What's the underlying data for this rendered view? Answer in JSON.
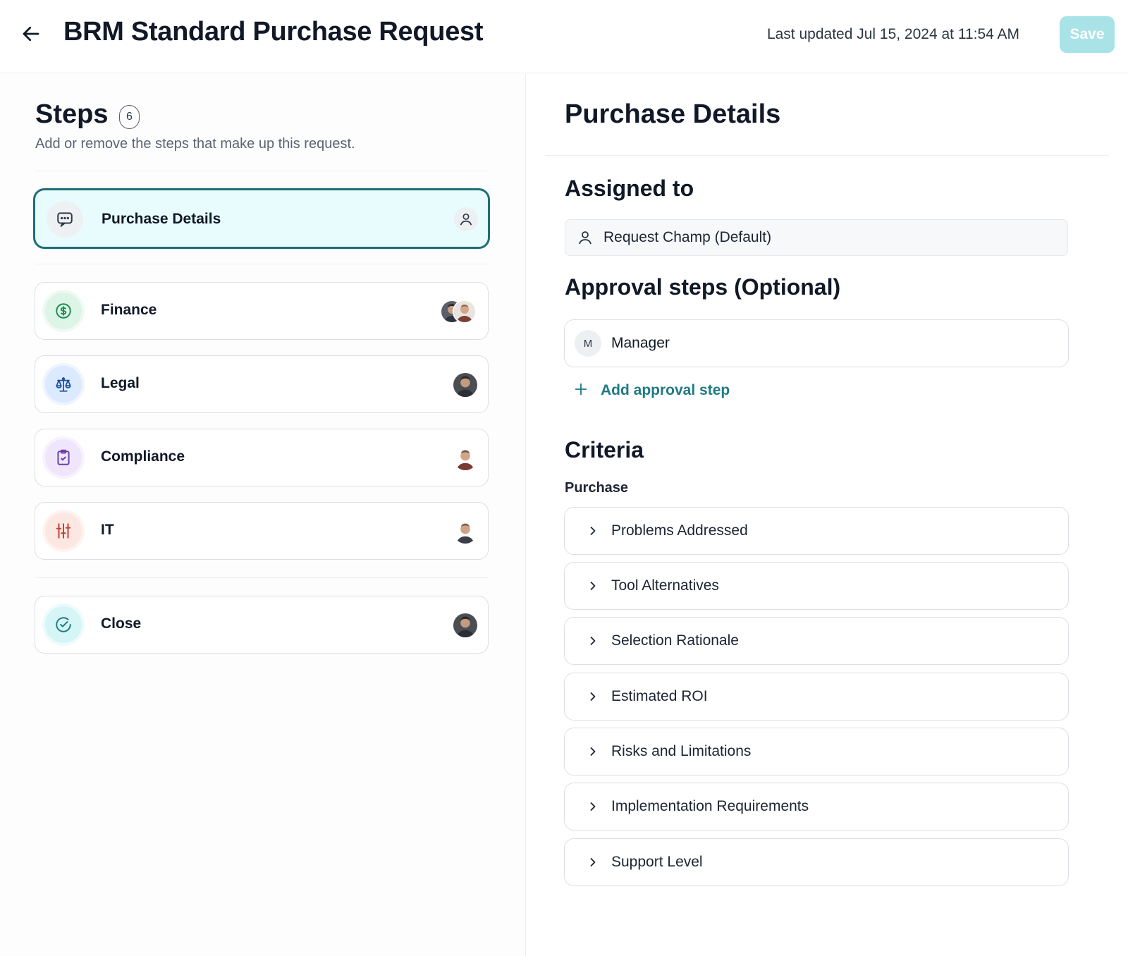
{
  "header": {
    "title": "BRM Standard Purchase Request",
    "last_updated": "Last updated Jul 15, 2024 at 11:54 AM",
    "save_label": "Save"
  },
  "colors": {
    "accent": "#1f7a83",
    "active_step_bg": "#e8fcfd",
    "active_step_border": "#1f6e77",
    "save_disabled_bg": "#a9e3e7"
  },
  "steps_panel": {
    "title": "Steps",
    "count": "6",
    "subtitle": "Add or remove the steps that make up this request.",
    "steps": [
      {
        "label": "Purchase Details",
        "icon": "chat-icon",
        "active": true,
        "avatar": "user-icon"
      },
      {
        "label": "Finance",
        "icon": "dollar-icon",
        "active": false,
        "avatar": "two-people-avatars"
      },
      {
        "label": "Legal",
        "icon": "scale-icon",
        "active": false,
        "avatar": "person-avatar"
      },
      {
        "label": "Compliance",
        "icon": "clipboard-check-icon",
        "active": false,
        "avatar": "person-avatar"
      },
      {
        "label": "IT",
        "icon": "sliders-icon",
        "active": false,
        "avatar": "person-avatar"
      },
      {
        "label": "Close",
        "icon": "check-circle-icon",
        "active": false,
        "avatar": "person-avatar"
      }
    ]
  },
  "details": {
    "title": "Purchase Details",
    "assigned_heading": "Assigned to",
    "assignee": "Request Champ (Default)",
    "approval_heading": "Approval steps (Optional)",
    "approval_steps": [
      {
        "initial": "M",
        "label": "Manager"
      }
    ],
    "add_approval_label": "Add approval step",
    "criteria_heading": "Criteria",
    "criteria_group": "Purchase",
    "criteria_items": [
      "Problems Addressed",
      "Tool Alternatives",
      "Selection Rationale",
      "Estimated ROI",
      "Risks and Limitations",
      "Implementation Requirements",
      "Support Level"
    ]
  }
}
